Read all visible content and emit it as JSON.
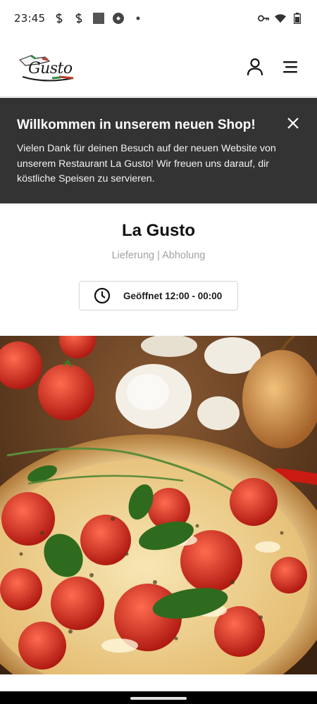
{
  "status_bar": {
    "time": "23:45",
    "left_icons": [
      "s-notification-icon",
      "s-notification-icon",
      "square-app-icon",
      "circle-app-icon",
      "dot-icon"
    ],
    "right_icons": [
      "key-icon",
      "wifi-icon",
      "battery-icon"
    ]
  },
  "header": {
    "logo_text": "Gusto",
    "icons": [
      "user-icon",
      "menu-icon"
    ]
  },
  "banner": {
    "title": "Willkommen in unserem neuen Shop!",
    "text": "Vielen Dank für deinen Besuch auf der neuen Website von unserem Restaurant La Gusto! Wir freuen uns darauf, dir köstliche Speisen zu servieren.",
    "background_color": "#333333"
  },
  "restaurant": {
    "name": "La Gusto",
    "modes": "Lieferung | Abholung",
    "hours": "Geöffnet 12:00 - 00:00"
  },
  "hero": {
    "image_alt": "pizza-image"
  }
}
